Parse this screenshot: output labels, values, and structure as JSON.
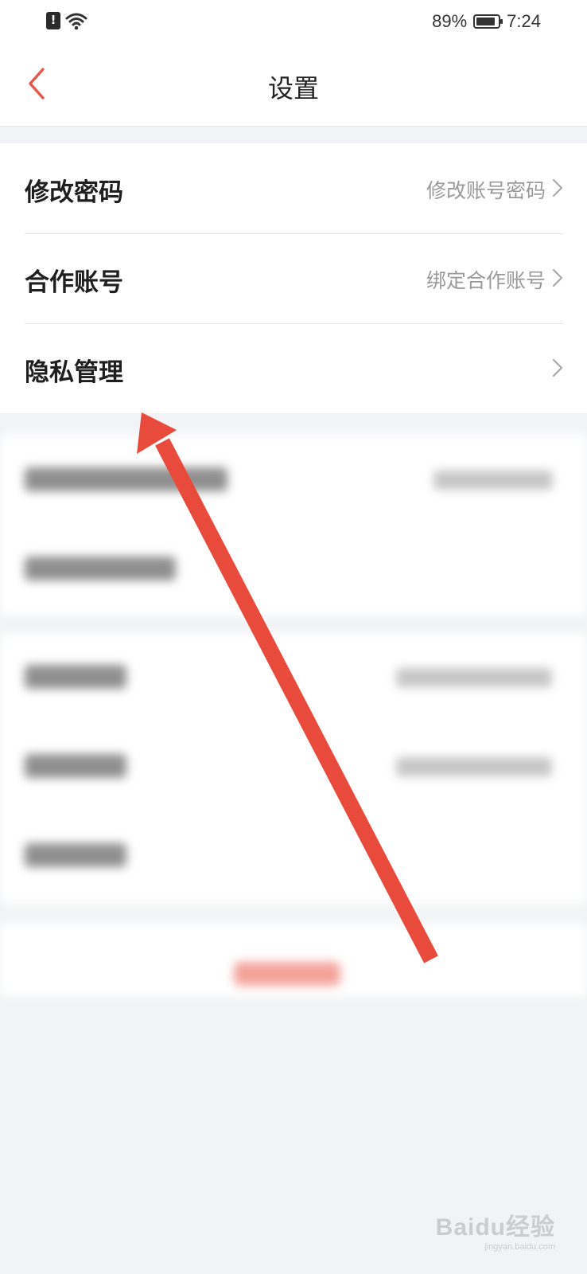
{
  "status_bar": {
    "battery_percent": "89%",
    "battery_level": 0.89,
    "time": "7:24",
    "icons": [
      "sim-alert-icon",
      "wifi-icon",
      "battery-icon"
    ]
  },
  "header": {
    "title": "设置",
    "back_icon": "chevron-left-icon"
  },
  "settings": {
    "items": [
      {
        "label": "修改密码",
        "detail": "修改账号密码"
      },
      {
        "label": "合作账号",
        "detail": "绑定合作账号"
      },
      {
        "label": "隐私管理",
        "detail": ""
      }
    ]
  },
  "colors": {
    "accent": "#e5574b",
    "arrow": "#e84a3b",
    "page_background": "#f1f3f6",
    "card_background": "#ffffff",
    "primary_text": "#1f1f1f",
    "secondary_text": "#9a9a9a"
  },
  "watermark": {
    "brand": "Baidu经验",
    "url": "jingyan.baidu.com"
  }
}
